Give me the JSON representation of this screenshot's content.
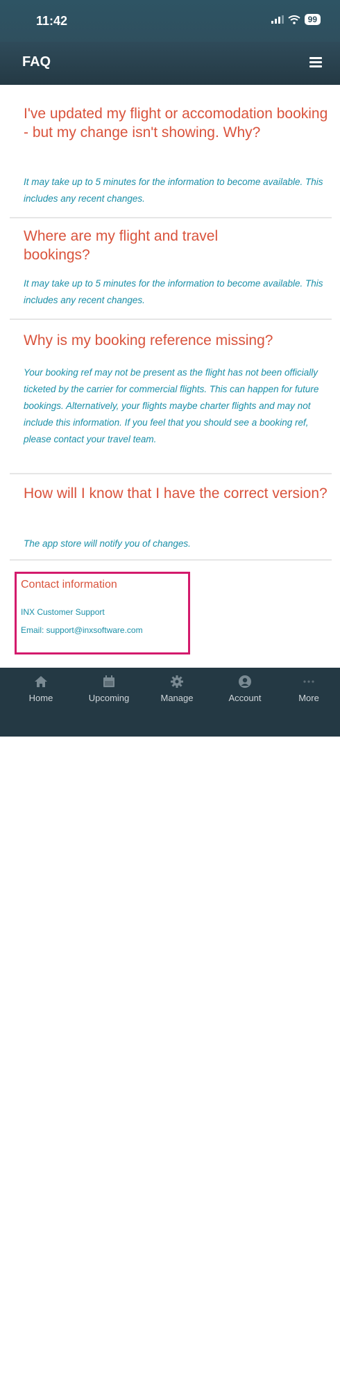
{
  "status_bar": {
    "time": "11:42",
    "battery": "99"
  },
  "header": {
    "title": "FAQ"
  },
  "faqs": [
    {
      "question": "I've updated my flight or accomodation booking - but my change isn't showing. Why?",
      "answer": "It may take up to 5 minutes for the information to become available. This includes any recent changes."
    },
    {
      "question": "Where are my flight and travel bookings?",
      "answer": "It may take up to 5 minutes for the information to become available. This includes any recent changes."
    },
    {
      "question": "Why is my booking reference missing?",
      "answer": "Your booking ref may not be present as the flight has not been officially ticketed by the carrier for commercial flights. This can happen for future bookings. Alternatively, your flights maybe charter flights and may not include this information. If you feel that you should see a booking ref, please contact your travel team."
    },
    {
      "question": "How will I know that I have the correct version?",
      "answer": "The app store will notify you of changes."
    }
  ],
  "contact": {
    "title": "Contact information",
    "name": "INX Customer Support",
    "email": "Email: support@inxsoftware.com"
  },
  "tabbar": {
    "items": [
      {
        "label": "Home",
        "icon": "home-icon"
      },
      {
        "label": "Upcoming",
        "icon": "calendar-icon"
      },
      {
        "label": "Manage",
        "icon": "gear-icon"
      },
      {
        "label": "Account",
        "icon": "user-icon"
      },
      {
        "label": "More",
        "icon": "more-icon"
      }
    ]
  },
  "colors": {
    "header": "#243944",
    "question": "#d9533c",
    "answer": "#1b8fa8",
    "highlight": "#d31a6c"
  }
}
